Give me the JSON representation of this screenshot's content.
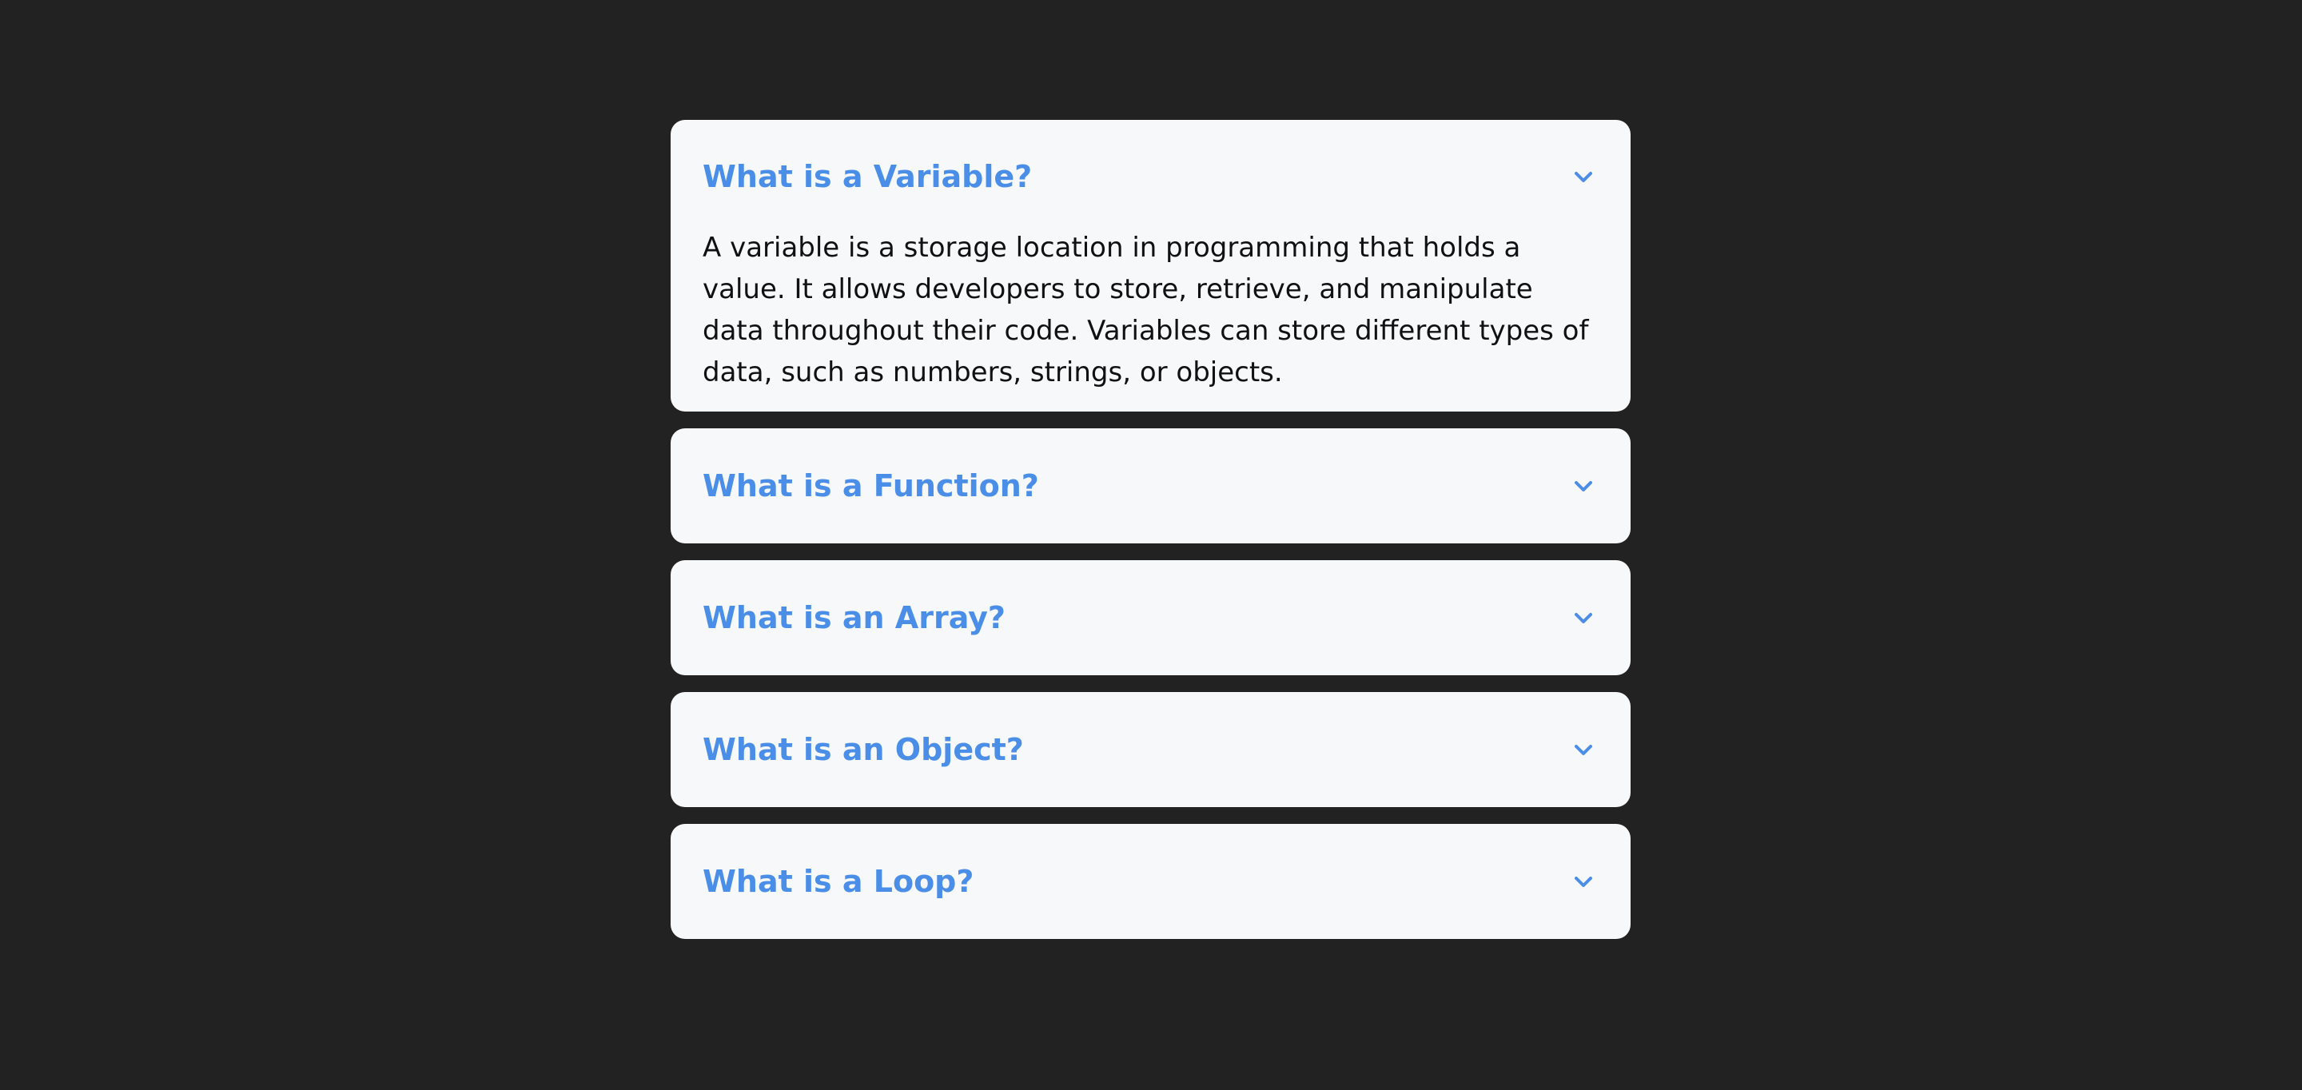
{
  "faq": {
    "items": [
      {
        "question": "What is a Variable?",
        "answer": "A variable is a storage location in programming that holds a value. It allows developers to store, retrieve, and manipulate data throughout their code. Variables can store different types of data, such as numbers, strings, or objects.",
        "expanded": true
      },
      {
        "question": "What is a Function?",
        "expanded": false
      },
      {
        "question": "What is an Array?",
        "expanded": false
      },
      {
        "question": "What is an Object?",
        "expanded": false
      },
      {
        "question": "What is a Loop?",
        "expanded": false
      }
    ]
  },
  "colors": {
    "background": "#222222",
    "card": "#f7f8fa",
    "accent": "#4a8ee8",
    "answer_text": "#111111"
  },
  "icons": {
    "toggle": "chevron-down-icon"
  }
}
